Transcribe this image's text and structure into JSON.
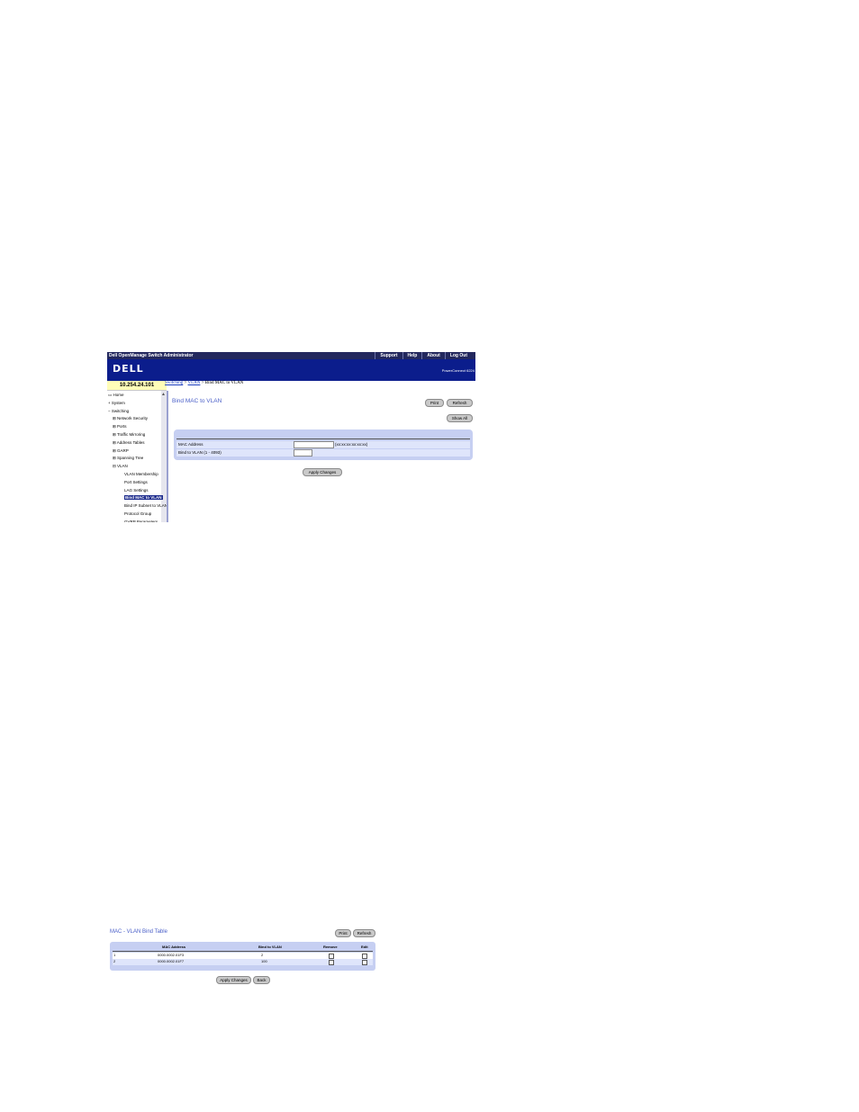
{
  "header": {
    "app_title": "Dell OpenManage Switch Administrator",
    "links": [
      "Support",
      "Help",
      "About",
      "Log Out"
    ],
    "logo": "DELL",
    "product": "PowerConnect 6224"
  },
  "ip_address": "10.254.24.101",
  "breadcrumb": {
    "part1": "Switching",
    "sep1": " > ",
    "part2": "VLAN",
    "sep2": " > ",
    "current": "Bind MAC to VLAN"
  },
  "sidebar": {
    "items": [
      {
        "label": "Home",
        "prefix": "▭"
      },
      {
        "label": "System",
        "prefix": "+"
      },
      {
        "label": "Switching",
        "prefix": "−"
      },
      {
        "label": "Network Security",
        "prefix": "⊞"
      },
      {
        "label": "Ports",
        "prefix": "⊞"
      },
      {
        "label": "Traffic Mirroring",
        "prefix": "⊞"
      },
      {
        "label": "Address Tables",
        "prefix": "⊞"
      },
      {
        "label": "GARP",
        "prefix": "⊞"
      },
      {
        "label": "Spanning Tree",
        "prefix": "⊞"
      },
      {
        "label": "VLAN",
        "prefix": "⊟"
      },
      {
        "label": "VLAN Membership",
        "prefix": ""
      },
      {
        "label": "Port Settings",
        "prefix": ""
      },
      {
        "label": "LAG Settings",
        "prefix": ""
      },
      {
        "label": "Bind MAC to VLAN",
        "prefix": ""
      },
      {
        "label": "Bind IP Subnet to VLAN",
        "prefix": ""
      },
      {
        "label": "Protocol Group",
        "prefix": ""
      },
      {
        "label": "GVRP Parameters",
        "prefix": ""
      }
    ]
  },
  "page": {
    "title": "Bind MAC to VLAN",
    "buttons": {
      "print": "Print",
      "refresh": "Refresh",
      "show_all": "Show All",
      "apply": "Apply Changes"
    },
    "form": {
      "mac_label": "MAC Address",
      "mac_value": "",
      "mac_hint": "(xx:xx:xx:xx:xx:xx)",
      "vlan_label": "Bind to VLAN (1 - 4093)",
      "vlan_value": ""
    }
  },
  "table_page": {
    "title": "MAC - VLAN Bind Table",
    "buttons": {
      "print": "Print",
      "refresh": "Refresh",
      "apply": "Apply Changes",
      "back": "Back"
    },
    "columns": [
      "",
      "MAC Address",
      "Bind to VLAN",
      "Remove",
      "Edit"
    ],
    "rows": [
      {
        "index": "1",
        "mac": "0000.0002.01F3",
        "vlan": "2",
        "remove": false,
        "edit": false
      },
      {
        "index": "2",
        "mac": "0000.0002.01F7",
        "vlan": "100",
        "remove": false,
        "edit": false
      }
    ]
  }
}
